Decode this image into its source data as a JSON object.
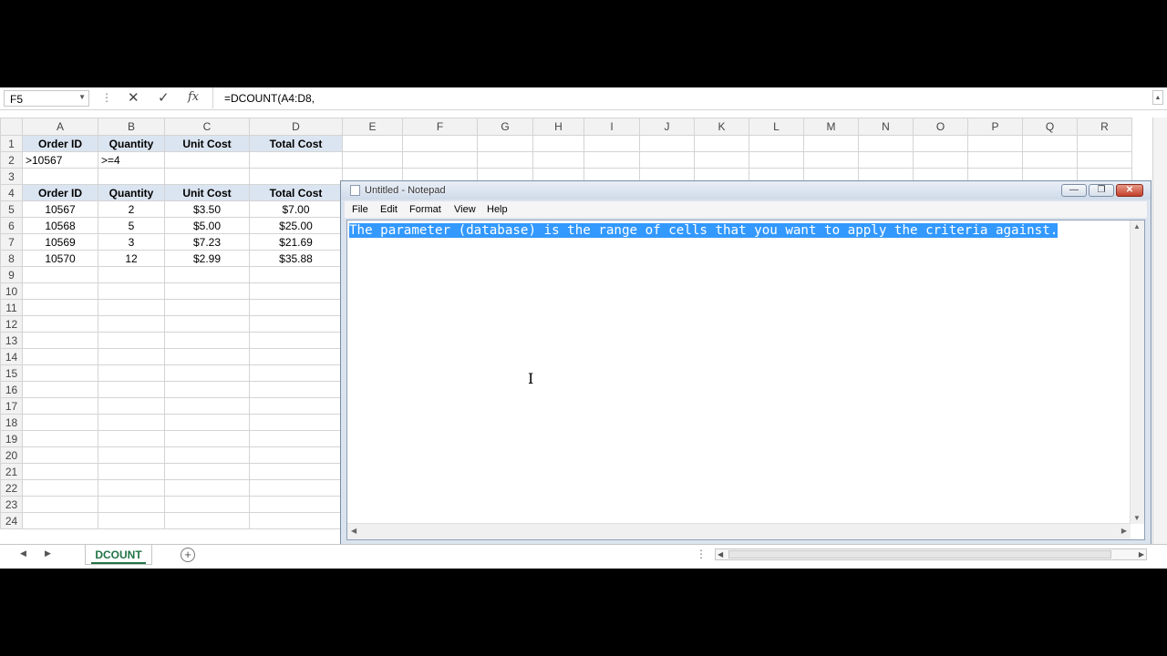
{
  "formula_bar": {
    "name_box": "F5",
    "name_box_arrow": "▼",
    "dots": "⋮",
    "cancel_glyph": "✕",
    "enter_glyph": "✓",
    "fx_label": "fx",
    "formula": "=DCOUNT(A4:D8,"
  },
  "grid": {
    "columns": [
      "A",
      "B",
      "C",
      "D",
      "E",
      "F",
      "G",
      "H",
      "I",
      "J",
      "K",
      "L",
      "M",
      "N",
      "O",
      "P",
      "Q",
      "R"
    ],
    "rows": [
      {
        "n": "1",
        "cells": [
          "Order ID",
          "Quantity",
          "Unit Cost",
          "Total Cost"
        ]
      },
      {
        "n": "2",
        "cells": [
          ">10567",
          ">=4",
          "",
          ""
        ]
      },
      {
        "n": "3",
        "cells": [
          "",
          "",
          "",
          ""
        ]
      },
      {
        "n": "4",
        "cells": [
          "Order ID",
          "Quantity",
          "Unit Cost",
          "Total Cost"
        ]
      },
      {
        "n": "5",
        "cells": [
          "10567",
          "2",
          "$3.50",
          "$7.00"
        ]
      },
      {
        "n": "6",
        "cells": [
          "10568",
          "5",
          "$5.00",
          "$25.00"
        ]
      },
      {
        "n": "7",
        "cells": [
          "10569",
          "3",
          "$7.23",
          "$21.69"
        ]
      },
      {
        "n": "8",
        "cells": [
          "10570",
          "12",
          "$2.99",
          "$35.88"
        ]
      },
      {
        "n": "9",
        "cells": [
          "",
          "",
          "",
          ""
        ]
      },
      {
        "n": "10",
        "cells": [
          "",
          "",
          "",
          ""
        ]
      },
      {
        "n": "11",
        "cells": [
          "",
          "",
          "",
          ""
        ]
      },
      {
        "n": "12",
        "cells": [
          "",
          "",
          "",
          ""
        ]
      },
      {
        "n": "13",
        "cells": [
          "",
          "",
          "",
          ""
        ]
      },
      {
        "n": "14",
        "cells": [
          "",
          "",
          "",
          ""
        ]
      },
      {
        "n": "15",
        "cells": [
          "",
          "",
          "",
          ""
        ]
      },
      {
        "n": "16",
        "cells": [
          "",
          "",
          "",
          ""
        ]
      },
      {
        "n": "17",
        "cells": [
          "",
          "",
          "",
          ""
        ]
      },
      {
        "n": "18",
        "cells": [
          "",
          "",
          "",
          ""
        ]
      },
      {
        "n": "19",
        "cells": [
          "",
          "",
          "",
          ""
        ]
      },
      {
        "n": "20",
        "cells": [
          "",
          "",
          "",
          ""
        ]
      },
      {
        "n": "21",
        "cells": [
          "",
          "",
          "",
          ""
        ]
      },
      {
        "n": "22",
        "cells": [
          "",
          "",
          "",
          ""
        ]
      },
      {
        "n": "23",
        "cells": [
          "",
          "",
          "",
          ""
        ]
      },
      {
        "n": "24",
        "cells": [
          "",
          "",
          "",
          ""
        ]
      }
    ],
    "header_fill": "#dbe5f1"
  },
  "sheet_tabs": {
    "prev_glyph": "◀",
    "next_glyph": "▶",
    "active_tab": "DCOUNT",
    "add_glyph": "+",
    "dots": "⋮",
    "scroll_left": "◀",
    "scroll_right": "▶"
  },
  "notepad": {
    "title": "Untitled - Notepad",
    "min_glyph": "—",
    "max_glyph": "❐",
    "close_glyph": "✕",
    "menus": [
      "File",
      "Edit",
      "Format",
      "View",
      "Help"
    ],
    "text": "The parameter (database) is the range of cells that you want to apply the criteria against.",
    "selection_color": "#3399ff",
    "scroll_up": "▲",
    "scroll_down": "▼",
    "scroll_left": "◀",
    "scroll_right": "▶",
    "cursor_glyph": "I"
  }
}
